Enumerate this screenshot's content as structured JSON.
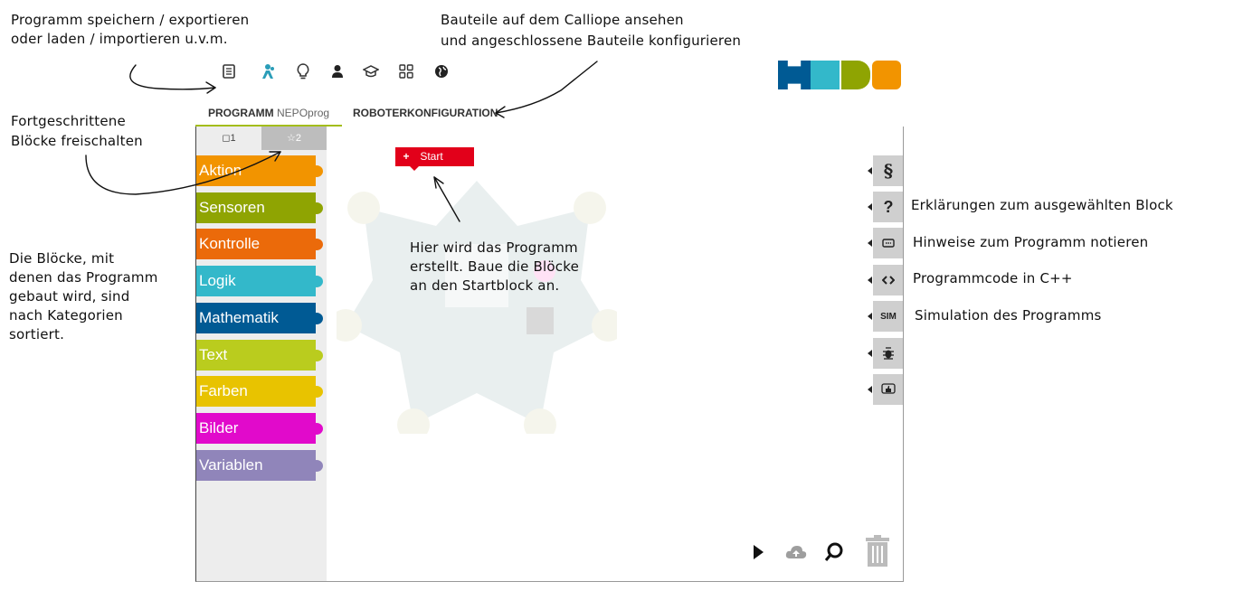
{
  "annotations": {
    "save_line1": "Programm speichern / exportieren",
    "save_line2": "oder laden / importieren u.v.m.",
    "config_line1": "Bauteile auf dem Calliope ansehen",
    "config_line2": "und angeschlossene Bauteile konfigurieren",
    "advanced_line1": "Fortgeschrittene",
    "advanced_line2": "Blöcke freischalten",
    "blocks_lines": [
      "Die Blöcke, mit",
      "denen das Programm",
      "gebaut wird, sind",
      "nach Kategorien",
      "sortiert."
    ],
    "program_lines": [
      "Hier wird das Programm",
      "erstellt. Baue die Blöcke",
      "an den Startblock an."
    ],
    "help": "Erklärungen zum ausgewählten Block",
    "notes": "Hinweise zum Programm notieren",
    "code": "Programmcode in C++",
    "sim": "Simulation des Programms"
  },
  "toolbar": {
    "icons": [
      "program-icon",
      "robot-icon",
      "lightbulb-icon",
      "user-icon",
      "education-icon",
      "gallery-icon",
      "language-icon"
    ]
  },
  "tabs": {
    "program_label": "PROGRAMM",
    "program_name": "NEPOprog",
    "config_label": "ROBOTERKONFIGURATION"
  },
  "levels": {
    "level1": "◻1",
    "level2": "☆2"
  },
  "categories": [
    {
      "label": "Aktion",
      "color": "#f29400"
    },
    {
      "label": "Sensoren",
      "color": "#8fa402"
    },
    {
      "label": "Kontrolle",
      "color": "#eb6a0a"
    },
    {
      "label": "Logik",
      "color": "#33b8ca"
    },
    {
      "label": "Mathematik",
      "color": "#005a94"
    },
    {
      "label": "Text",
      "color": "#bacc1e"
    },
    {
      "label": "Farben",
      "color": "#e8c300"
    },
    {
      "label": "Bilder",
      "color": "#e10acb"
    },
    {
      "label": "Variablen",
      "color": "#9085ba"
    }
  ],
  "start_block": {
    "plus": "+",
    "label": "Start"
  },
  "side_buttons": {
    "sim_label": "SIM",
    "icons": [
      "paragraph-icon",
      "help-icon",
      "comment-icon",
      "code-icon",
      "sim-icon",
      "debug-icon",
      "feedback-icon"
    ]
  },
  "colors": {
    "accent_green": "#a3bd1b",
    "start_red": "#e2001a",
    "logo": [
      "#005a94",
      "#33b8ca",
      "#8fa402",
      "#f29400"
    ]
  }
}
